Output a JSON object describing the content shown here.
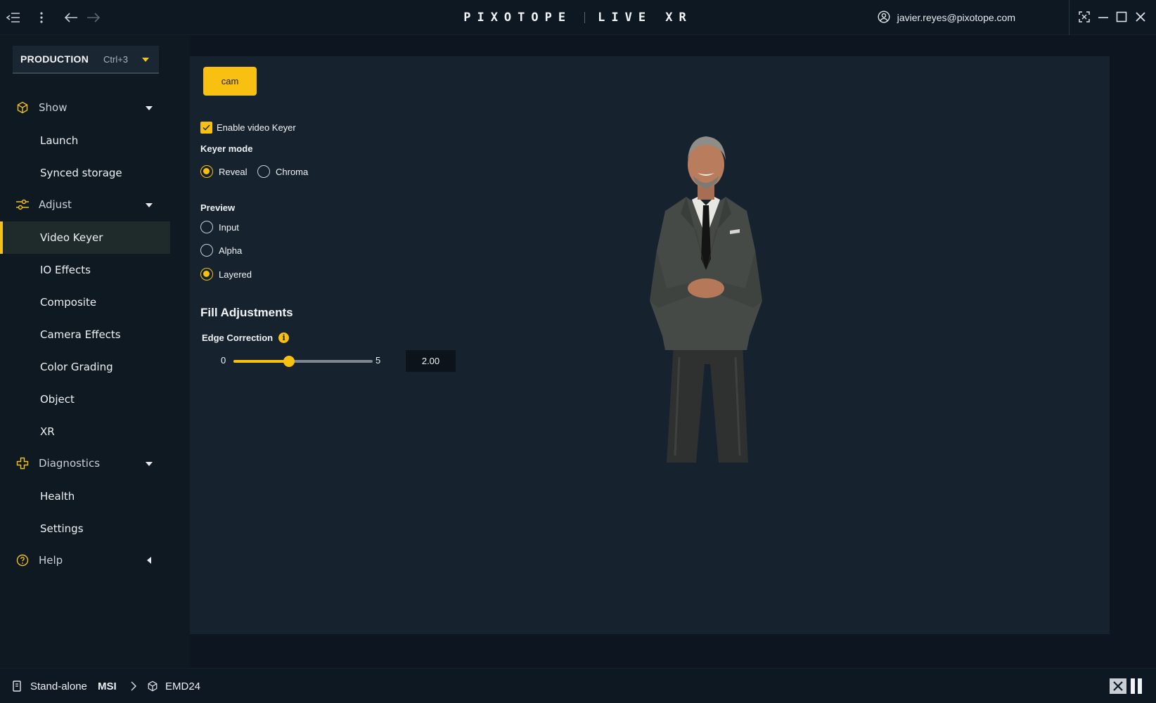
{
  "titlebar": {
    "brand_left": "PIXOTOPE",
    "brand_right": "LIVE XR",
    "account_email": "javier.reyes@pixotope.com"
  },
  "sidebar": {
    "production": {
      "label": "PRODUCTION",
      "shortcut": "Ctrl+3"
    },
    "groups": [
      {
        "label": "Show",
        "icon": "cube-icon",
        "expanded": true,
        "items": [
          "Launch",
          "Synced storage"
        ]
      },
      {
        "label": "Adjust",
        "icon": "sliders-icon",
        "expanded": true,
        "items": [
          "Video Keyer",
          "IO Effects",
          "Composite",
          "Camera Effects",
          "Color Grading",
          "Object",
          "XR"
        ]
      },
      {
        "label": "Diagnostics",
        "icon": "plus-cross-icon",
        "expanded": true,
        "items": [
          "Health",
          "Settings"
        ]
      },
      {
        "label": "Help",
        "icon": "question-circle-icon",
        "expanded": false,
        "items": []
      }
    ],
    "active_item": "Video Keyer"
  },
  "main": {
    "cam_button": "cam",
    "enable_keyer": {
      "label": "Enable video Keyer",
      "checked": true
    },
    "keyer_mode": {
      "label": "Keyer mode",
      "options": [
        "Reveal",
        "Chroma"
      ],
      "selected": "Reveal"
    },
    "preview": {
      "label": "Preview",
      "options": [
        "Input",
        "Alpha",
        "Layered"
      ],
      "selected": "Layered"
    },
    "fill_adjustments": {
      "heading": "Fill Adjustments",
      "edge_correction": {
        "label": "Edge Correction",
        "min": "0",
        "max": "5",
        "value": 2.0,
        "value_text": "2.00"
      }
    }
  },
  "statusbar": {
    "mode": "Stand-alone",
    "machine": "MSI",
    "node": "EMD24"
  },
  "colors": {
    "accent": "#f8c010",
    "background": "#0d1620",
    "panel": "#16222e",
    "sidebar": "#0f1922"
  }
}
